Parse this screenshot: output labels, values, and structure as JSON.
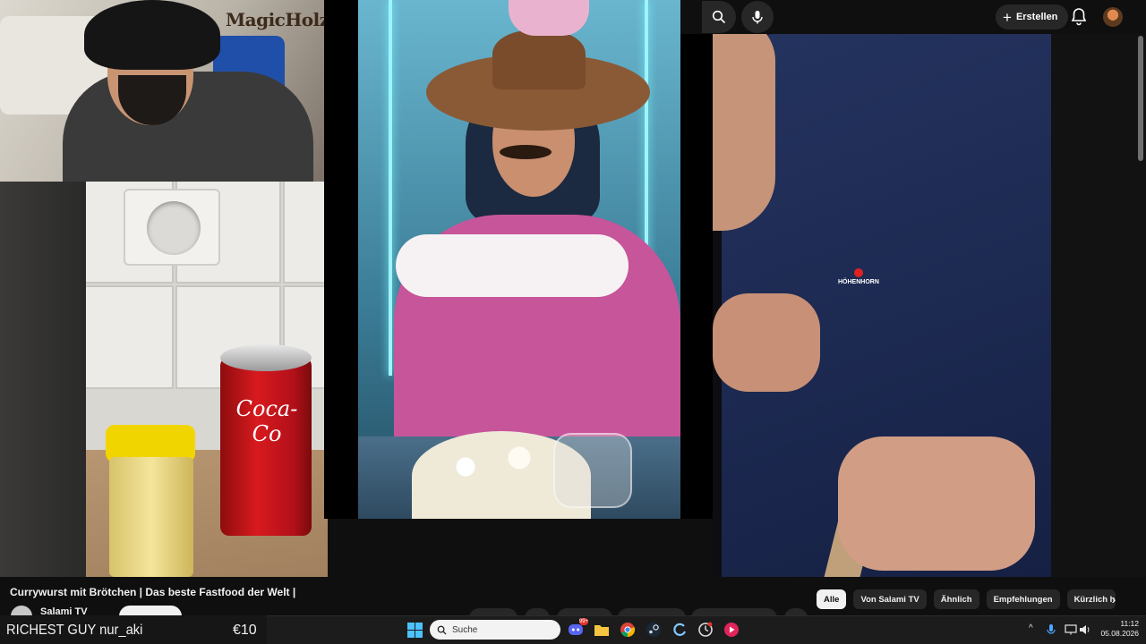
{
  "header": {
    "create_label": "Erstellen"
  },
  "watermark": "MagicHolz",
  "can_text": "Coca-Co",
  "brand_logo": "HÖHENHORN",
  "video": {
    "title": "Currywurst mit Brötchen | Das beste Fastfood der Welt |",
    "channel": "Salami TV"
  },
  "chips": [
    {
      "label": "Alle",
      "active": true
    },
    {
      "label": "Von Salami TV",
      "active": false
    },
    {
      "label": "Ähnlich",
      "active": false
    },
    {
      "label": "Empfehlungen",
      "active": false
    },
    {
      "label": "Kürzlich ho",
      "active": false
    }
  ],
  "overlay": {
    "text": "RICHEST GUY nur_aki",
    "amount": "€10"
  },
  "taskbar": {
    "search_placeholder": "Suche",
    "discord_badge": "99+"
  },
  "clock": {
    "time": "11:12",
    "date": "05.08.2026"
  },
  "colors": {
    "background": "#0f0f0f",
    "chip_bg": "#272727",
    "chip_active_bg": "#f1f1f1",
    "taskbar_bg": "#1c1c1c"
  }
}
